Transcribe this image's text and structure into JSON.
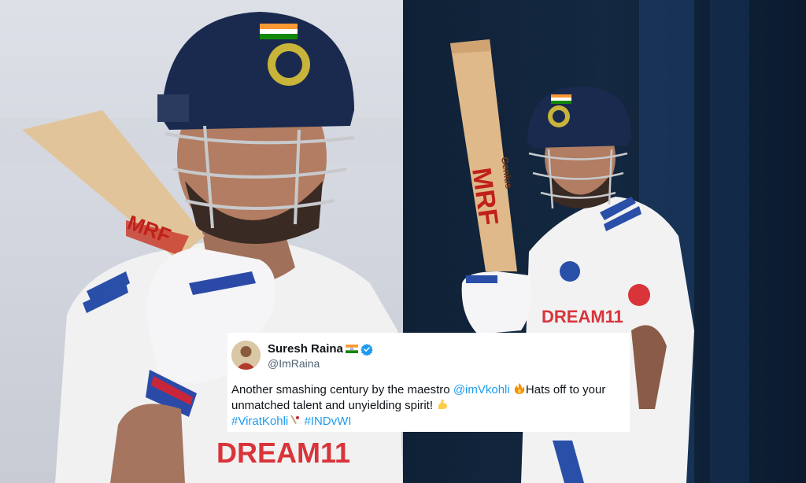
{
  "tweet": {
    "author_name": "Suresh Raina",
    "author_handle": "@ImRaina",
    "text_part1": "Another smashing century by the maestro ",
    "mention": "@imVkohli",
    "text_part2": "Hats off to your unmatched talent and unyielding spirit! ",
    "hashtag1": "#ViratKohli",
    "hashtag2": "#INDvWI"
  },
  "photos": {
    "left": {
      "bat_brand": "MRF",
      "shirt_sponsor": "DREAM11"
    },
    "right": {
      "bat_brand": "MRF",
      "bat_text": "Genius",
      "shirt_sponsor": "DREAM11"
    }
  },
  "colors": {
    "link": "#1d9bf0",
    "verified": "#1d9bf0",
    "helmet": "#1a2a4f",
    "jersey": "#f3f3f3"
  },
  "icons": [
    "flag-icon",
    "verified-badge-icon",
    "fire-emoji-icon",
    "flexed-biceps-emoji-icon",
    "cricket-emoji-icon"
  ]
}
